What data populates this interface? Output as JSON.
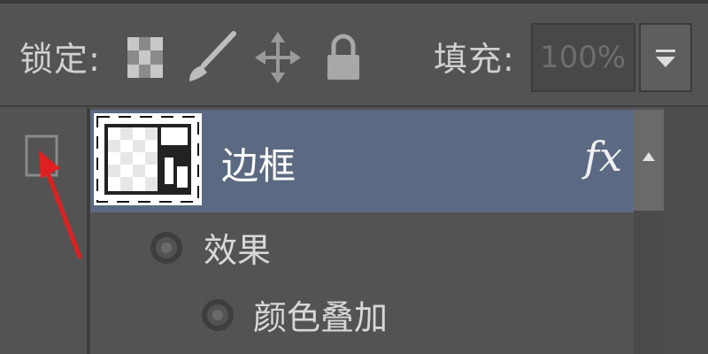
{
  "toolbar": {
    "lock_label": "锁定:",
    "fill_label": "填充:",
    "fill_value": "100%",
    "lock_icons": [
      "transparency-lock-icon",
      "brush-icon",
      "move-arrows-icon",
      "padlock-icon"
    ]
  },
  "layer": {
    "name": "边框",
    "fx_label": "fx"
  },
  "effects": {
    "group_label": "效果",
    "items": [
      {
        "label": "颜色叠加"
      }
    ]
  },
  "colors": {
    "panel_bg": "#535353",
    "selected_row": "#5b6a82",
    "annotation_arrow": "#e02020"
  }
}
